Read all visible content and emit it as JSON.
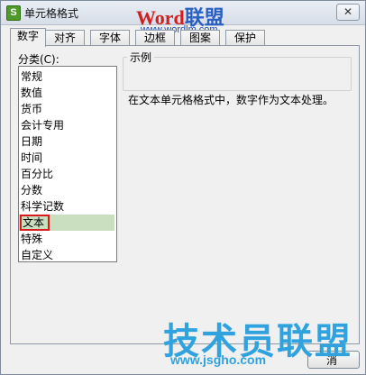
{
  "window": {
    "title": "单元格格式",
    "close_symbol": "✕",
    "app_icon_letter": "S"
  },
  "watermarks": {
    "word_part1": "Word",
    "word_part2": "联盟",
    "word_url": "www.wordlm.com",
    "jsgho_title": "技术员联盟",
    "jsgho_url": "www.jsgho.com"
  },
  "tabs": [
    {
      "label": "数字",
      "active": true
    },
    {
      "label": "对齐",
      "active": false
    },
    {
      "label": "字体",
      "active": false
    },
    {
      "label": "边框",
      "active": false
    },
    {
      "label": "图案",
      "active": false
    },
    {
      "label": "保护",
      "active": false
    }
  ],
  "category": {
    "label": "分类(C):",
    "items": [
      "常规",
      "数值",
      "货币",
      "会计专用",
      "日期",
      "时间",
      "百分比",
      "分数",
      "科学记数",
      "文本",
      "特殊",
      "自定义"
    ],
    "selected": "文本"
  },
  "sample": {
    "title": "示例",
    "value": ""
  },
  "description": "在文本单元格格式中，数字作为文本处理。",
  "buttons": {
    "cancel_label": "消"
  }
}
